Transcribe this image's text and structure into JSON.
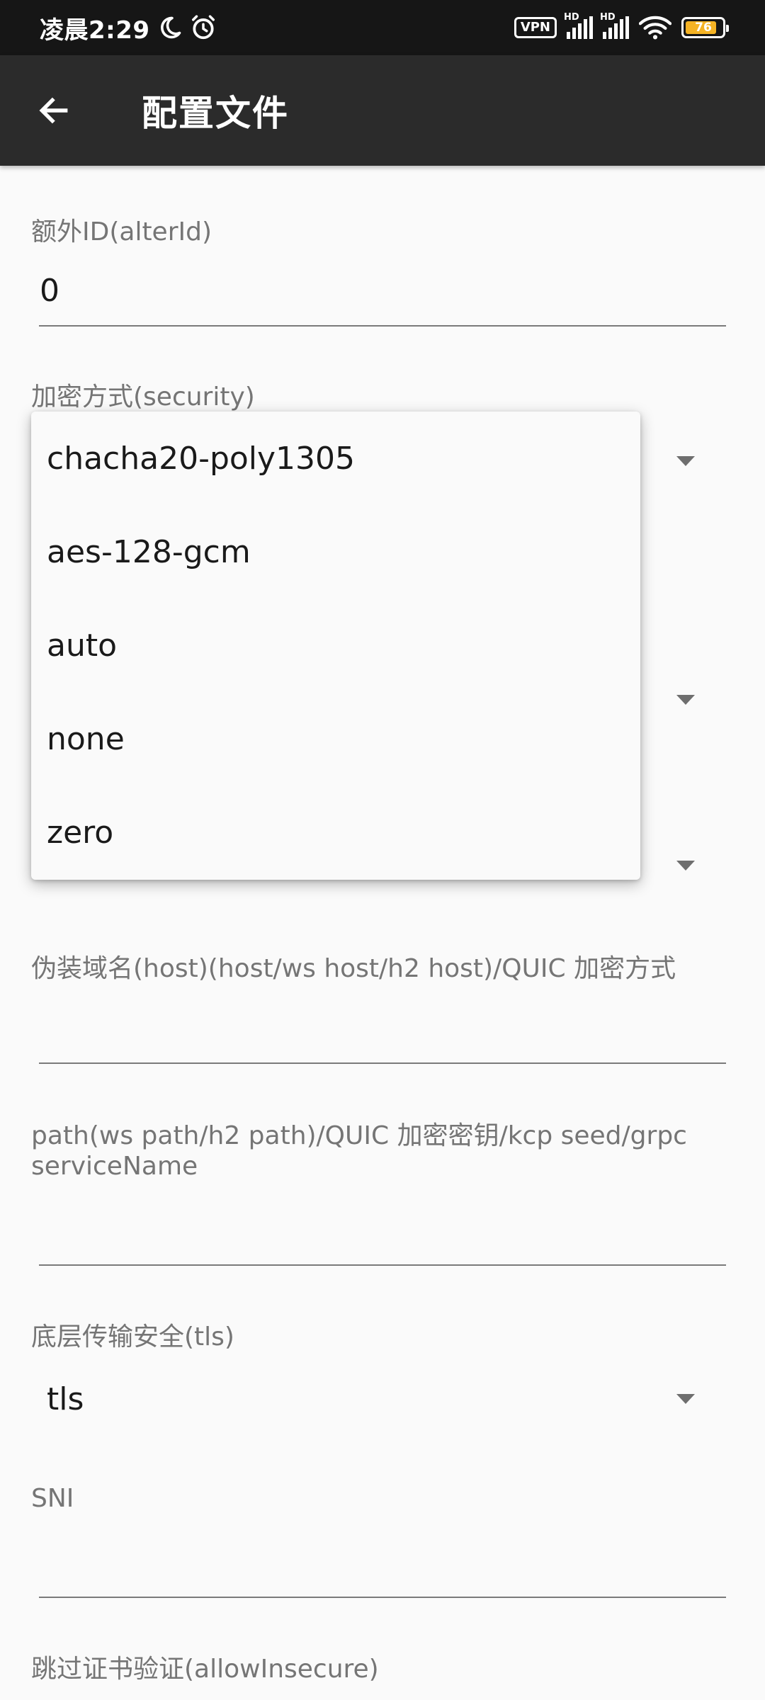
{
  "status_bar": {
    "time": "凌晨2:29",
    "vpn": "VPN",
    "hd1": "HD",
    "hd2": "HD",
    "battery": "76",
    "battery_level": 0.76
  },
  "app_bar": {
    "title": "配置文件"
  },
  "form": {
    "alter_id_label": "额外ID(alterId)",
    "alter_id_value": "0",
    "security_label": "加密方式(security)",
    "host_label": "伪装域名(host)(host/ws host/h2 host)/QUIC 加密方式",
    "path_label_line1": "path(ws path/h2 path)/QUIC 加密密钥/kcp seed/grpc",
    "path_label_line2": "serviceName",
    "tls_label": "底层传输安全(tls)",
    "tls_value": "tls",
    "sni_label": "SNI",
    "allow_insecure_label": "跳过证书验证(allowInsecure)"
  },
  "security_menu": {
    "options": [
      "chacha20-poly1305",
      "aes-128-gcm",
      "auto",
      "none",
      "zero"
    ]
  }
}
